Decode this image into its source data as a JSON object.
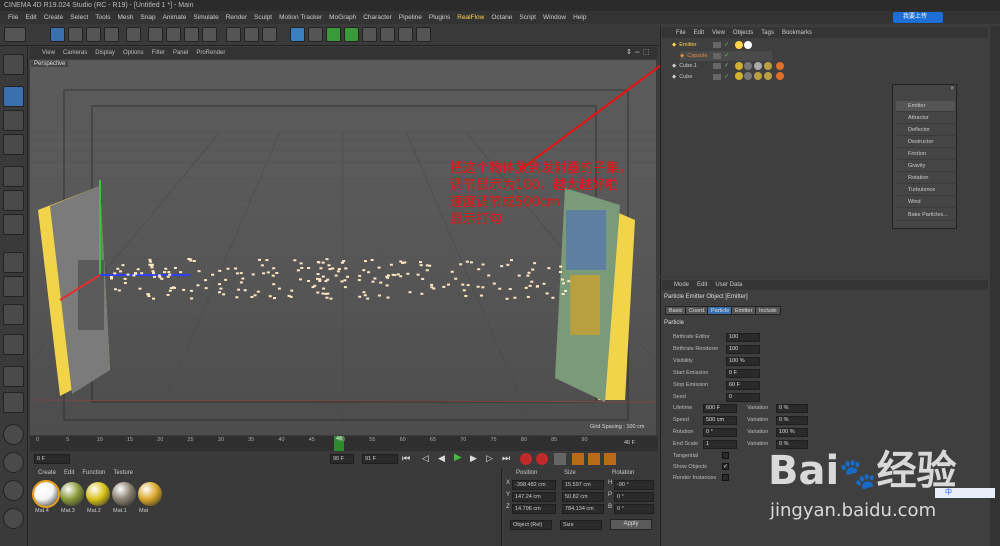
{
  "app": {
    "title": "CINEMA 4D R19.024 Studio (RC - R19) - [Untitled 1 *] - Main"
  },
  "menu": [
    "File",
    "Edit",
    "Create",
    "Select",
    "Tools",
    "Mesh",
    "Snap",
    "Animate",
    "Simulate",
    "Render",
    "Sculpt",
    "Motion Tracker",
    "MoGraph",
    "Character",
    "Pipeline",
    "Plugins",
    "RealFlow",
    "Octane",
    "Script",
    "Window",
    "Help"
  ],
  "top_right_badge": "我要上传",
  "viewport": {
    "menu": [
      "View",
      "Cameras",
      "Display",
      "Options",
      "Filter",
      "Panel",
      "ProRender"
    ],
    "label": "Perspective",
    "grid_spacing": "Grid Spacing : 100 cm"
  },
  "annotation": {
    "lines": [
      "把这个物体放到发射器的子集，",
      "调节显示为100，越大越好啦",
      "速度调节成500cm",
      "显示打勾"
    ]
  },
  "timeline": {
    "ticks": [
      "0",
      "5",
      "10",
      "15",
      "20",
      "25",
      "30",
      "35",
      "40",
      "45",
      "50",
      "55",
      "60",
      "65",
      "70",
      "75",
      "80",
      "85",
      "90"
    ],
    "current": "46",
    "end_label": "46 F",
    "start_field": "0 F",
    "end_field": "90 F",
    "max_field": "91 F"
  },
  "materials": {
    "menu": [
      "Create",
      "Edit",
      "Function",
      "Texture"
    ],
    "items": [
      {
        "label": "Mat.4",
        "color": "#f4f4f4"
      },
      {
        "label": "Mat.3",
        "color": "#8a9a3a"
      },
      {
        "label": "Mat.2",
        "color": "#d8c21a"
      },
      {
        "label": "Mat.1",
        "color": "#8a8070"
      },
      {
        "label": "Mat",
        "color": "#d9a82a"
      }
    ]
  },
  "coords": {
    "headers": [
      "Position",
      "Size",
      "Rotation"
    ],
    "rows": [
      {
        "axis": "X",
        "pos": "-398.482 cm",
        "size": "15.597 cm",
        "rot_axis": "H",
        "rot": "-90 °"
      },
      {
        "axis": "Y",
        "pos": "147.24 cm",
        "size": "50.82 cm",
        "rot_axis": "P",
        "rot": "0 °"
      },
      {
        "axis": "Z",
        "pos": "14.796 cm",
        "size": "784.134 cm",
        "rot_axis": "B",
        "rot": "0 °"
      }
    ],
    "mode_select": "Object (Rel)",
    "size_select": "Size",
    "apply_label": "Apply"
  },
  "object_manager": {
    "menu": [
      "File",
      "Edit",
      "View",
      "Objects",
      "Tags",
      "Bookmarks"
    ],
    "objects": [
      {
        "name": "Emitter",
        "color": "#ffd34a"
      },
      {
        "name": "Capsule",
        "color": "#e08a3a"
      },
      {
        "name": "Cube.1",
        "color": "#cccccc"
      },
      {
        "name": "Cube",
        "color": "#cccccc"
      }
    ]
  },
  "particle_menu": {
    "items": [
      "Emitter",
      "Attractor",
      "Deflector",
      "Destructor",
      "Friction",
      "Gravity",
      "Rotation",
      "Turbulence",
      "Wind",
      "Bake Particles..."
    ]
  },
  "attributes": {
    "menu": [
      "Mode",
      "Edit",
      "User Data"
    ],
    "object_title": "Particle Emitter Object [Emitter]",
    "tabs": [
      "Basic",
      "Coord.",
      "Particle",
      "Emitter",
      "Include"
    ],
    "active_tab": "Particle",
    "section": "Particle",
    "fields": [
      {
        "label": "Birthrate Editor",
        "value": "100"
      },
      {
        "label": "Birthrate Renderer",
        "value": "100"
      },
      {
        "label": "Visibility",
        "value": "100 %"
      },
      {
        "label": "Start Emission",
        "value": "0 F"
      },
      {
        "label": "Stop Emission",
        "value": "60 F"
      },
      {
        "label": "Seed",
        "value": "0"
      }
    ],
    "pairs": [
      {
        "label": "Lifetime",
        "value": "600 F",
        "var_label": "Variation",
        "var": "0 %"
      },
      {
        "label": "Speed",
        "value": "500 cm",
        "var_label": "Variation",
        "var": "0 %"
      },
      {
        "label": "Rotation",
        "value": "0 °",
        "var_label": "Variation",
        "var": "100 %"
      },
      {
        "label": "End Scale",
        "value": "1",
        "var_label": "Variation",
        "var": "0 %"
      }
    ],
    "checks": [
      {
        "label": "Tangential",
        "checked": false
      },
      {
        "label": "Show Objects",
        "checked": true
      },
      {
        "label": "Render Instances",
        "checked": false
      }
    ]
  },
  "watermark": {
    "brand": "Bai",
    "brand2": "经验",
    "url": "jingyan.baidu.com"
  },
  "tray": "中"
}
